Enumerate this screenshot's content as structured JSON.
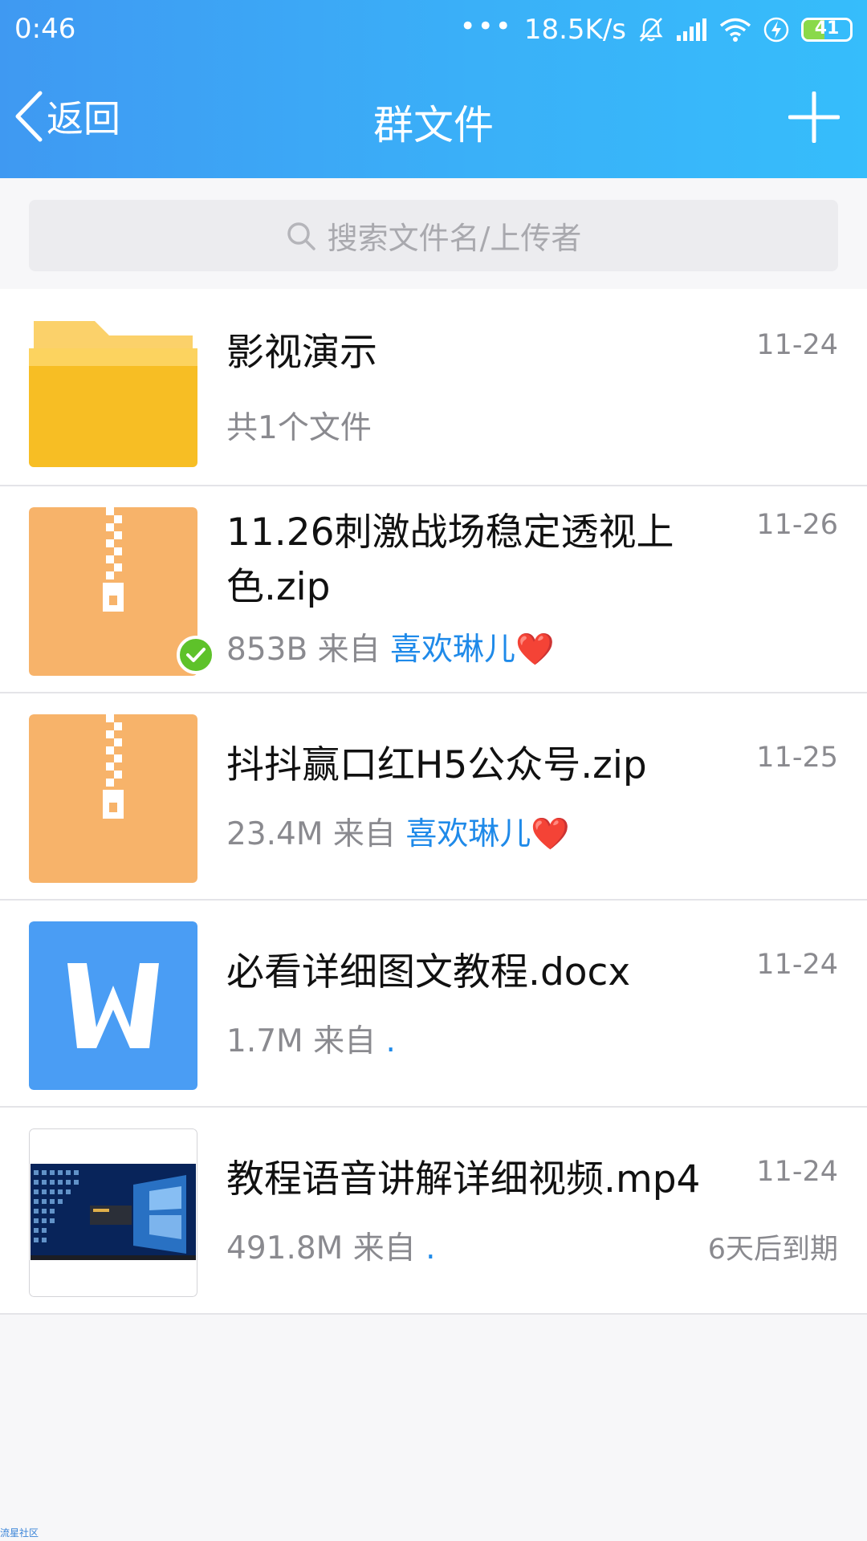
{
  "status_bar": {
    "time": "0:46",
    "network_speed": "18.5K/s",
    "battery": "41",
    "icons": [
      "dots-icon",
      "mute-icon",
      "signal-icon",
      "wifi-icon",
      "charging-icon",
      "battery-icon"
    ]
  },
  "nav": {
    "back_label": "返回",
    "title": "群文件",
    "add_icon": "plus-icon"
  },
  "search": {
    "placeholder": "搜索文件名/上传者",
    "icon": "search-icon"
  },
  "files": [
    {
      "type": "folder",
      "icon": "folder-icon",
      "name": "影视演示",
      "date": "11-24",
      "meta": "共1个文件"
    },
    {
      "type": "zip",
      "icon": "zip-icon",
      "name": "11.26刺激战场稳定透视上色.zip",
      "date": "11-26",
      "size": "853B",
      "from_label": "来自",
      "uploader": "喜欢琳儿",
      "uploader_suffix": "❤️",
      "downloaded": true
    },
    {
      "type": "zip",
      "icon": "zip-icon",
      "name": "抖抖赢口红H5公众号.zip",
      "date": "11-25",
      "size": "23.4M",
      "from_label": "来自",
      "uploader": "喜欢琳儿",
      "uploader_suffix": "❤️"
    },
    {
      "type": "docx",
      "icon": "word-doc-icon",
      "name": "必看详细图文教程.docx",
      "date": "11-24",
      "size": "1.7M",
      "from_label": "来自",
      "uploader": "."
    },
    {
      "type": "mp4",
      "icon": "video-thumbnail",
      "name": "教程语音讲解详细视频.mp4",
      "date": "11-24",
      "size": "491.8M",
      "from_label": "来自",
      "uploader": ".",
      "expiry": "6天后到期"
    }
  ],
  "footer_watermark": "流星社区",
  "colors": {
    "header_start": "#3f99f2",
    "header_end": "#36bdfb",
    "folder": "#f7c02c",
    "zip": "#f7b36a",
    "word": "#4a9df4",
    "uploader": "#1f8ae9",
    "check": "#5ec22a"
  }
}
